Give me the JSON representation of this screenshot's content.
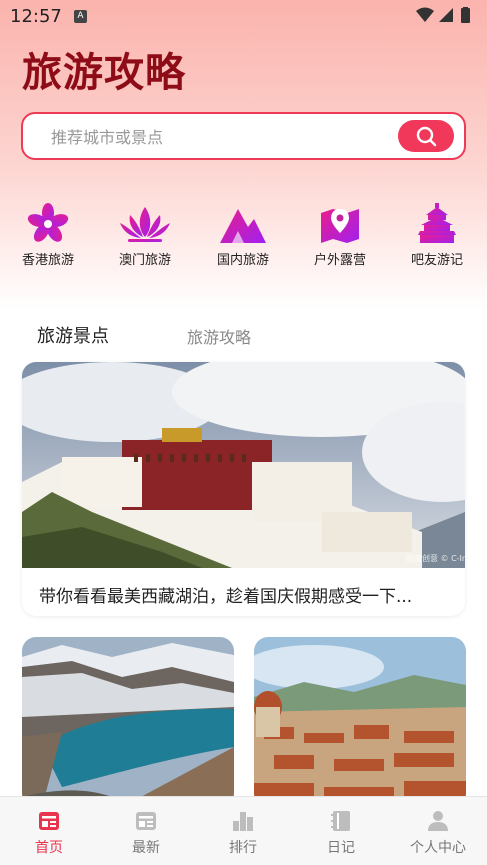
{
  "status_bar": {
    "time": "12:57",
    "badge": "A"
  },
  "header": {
    "title": "旅游攻略"
  },
  "search": {
    "placeholder": "推荐城市或景点",
    "icon": "search-icon"
  },
  "categories": [
    {
      "label": "香港旅游",
      "icon": "bauhinia-icon"
    },
    {
      "label": "澳门旅游",
      "icon": "lotus-icon"
    },
    {
      "label": "国内旅游",
      "icon": "mountain-icon"
    },
    {
      "label": "户外露营",
      "icon": "map-pin-icon"
    },
    {
      "label": "吧友游记",
      "icon": "temple-icon"
    }
  ],
  "tabs": {
    "active": "旅游景点",
    "inactive": "旅游攻略"
  },
  "feature": {
    "caption": "带你看看最美西藏湖泊，趁着国庆假期感受一下...",
    "watermark": "图虫创意 © C-In"
  },
  "bottom_nav": [
    {
      "label": "首页",
      "icon": "home-icon",
      "active": true
    },
    {
      "label": "最新",
      "icon": "news-icon",
      "active": false
    },
    {
      "label": "排行",
      "icon": "ranking-icon",
      "active": false
    },
    {
      "label": "日记",
      "icon": "diary-icon",
      "active": false
    },
    {
      "label": "个人中心",
      "icon": "profile-icon",
      "active": false
    }
  ],
  "colors": {
    "accent": "#f2385a",
    "title": "#8d0c17",
    "icon_gradient_start": "#e91e8c",
    "icon_gradient_end": "#a020f0"
  }
}
